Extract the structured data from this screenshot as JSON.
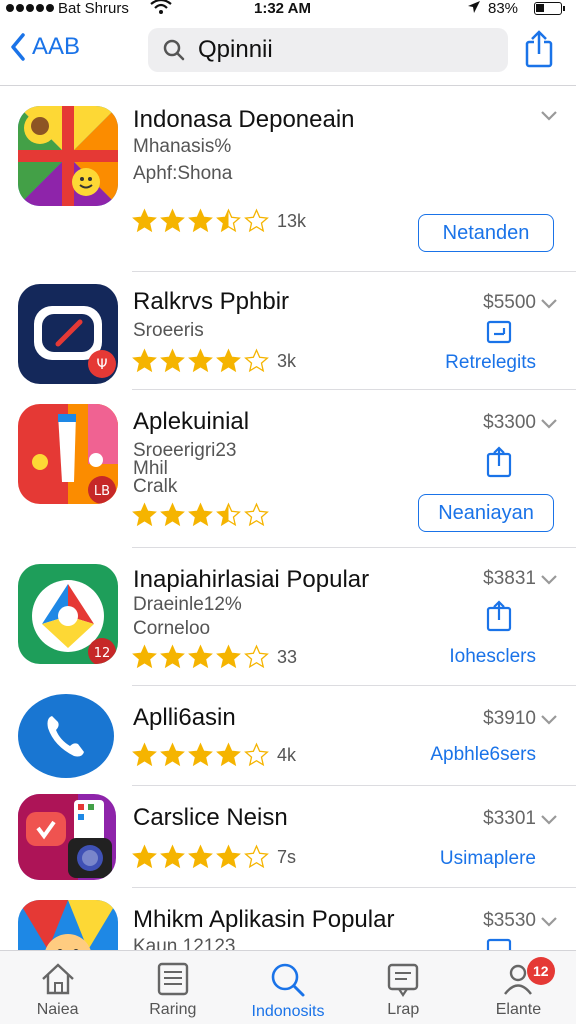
{
  "status_bar": {
    "carrier": "Bat Shrurs",
    "time": "1:32 AM",
    "battery": "83%"
  },
  "nav": {
    "back_label": "AAB",
    "search_value": "Qpinnii",
    "icons": [
      "chevron-left-icon",
      "search-icon",
      "share-icon"
    ]
  },
  "apps": [
    {
      "name": "Indonasa Deponeain",
      "subtitles": [
        "Mhanasis%",
        "Aphf:Shona"
      ],
      "rating": 3.5,
      "rating_count": "13k",
      "action_type": "button",
      "action_label": "Netanden"
    },
    {
      "name": "Ralkrvs Pphbir",
      "subtitles": [
        "Sroeeris"
      ],
      "rating": 4,
      "rating_count": "3k",
      "price": "$5500",
      "action_type": "link",
      "action_label": "Retrelegits"
    },
    {
      "name": "Aplekuinial",
      "subtitles": [
        "Sroeerigri23",
        "Mhil",
        "Cralk"
      ],
      "rating": 3.5,
      "rating_count": "",
      "price": "$3300",
      "action_type": "button",
      "action_label": "Neaniayan"
    },
    {
      "name": "Inapiahirlasiai Popular",
      "subtitles": [
        "Draeinle12%",
        "Corneloo"
      ],
      "rating": 4,
      "rating_count": "33",
      "price": "$3831",
      "action_type": "link",
      "action_label": "Iohesclers"
    },
    {
      "name": "Aplli6asin",
      "subtitles": [],
      "rating": 4,
      "rating_count": "4k",
      "price": "$3910",
      "action_type": "link",
      "action_label": "Apbhle6sers"
    },
    {
      "name": "Carslice Neisn",
      "subtitles": [],
      "rating": 4,
      "rating_count": "7s",
      "price": "$3301",
      "action_type": "link",
      "action_label": "Usimaplere"
    },
    {
      "name": "Mhikm Aplikasin Popular",
      "subtitles": [
        "Kaun 12123"
      ],
      "rating": 0,
      "rating_count": "",
      "price": "$3530",
      "action_type": "none",
      "action_label": ""
    }
  ],
  "tabs": [
    {
      "label": "Naiea",
      "icon": "home-icon",
      "active": false
    },
    {
      "label": "Raring",
      "icon": "chart-list-icon",
      "active": false
    },
    {
      "label": "Indonosits",
      "icon": "search-icon",
      "active": true
    },
    {
      "label": "Lrap",
      "icon": "updates-icon",
      "active": false
    },
    {
      "label": "Elante",
      "icon": "account-icon",
      "active": false,
      "badge": "12"
    }
  ],
  "colors": {
    "accent": "#1a73e8",
    "star": "#f5b400",
    "badge": "#e53935"
  }
}
